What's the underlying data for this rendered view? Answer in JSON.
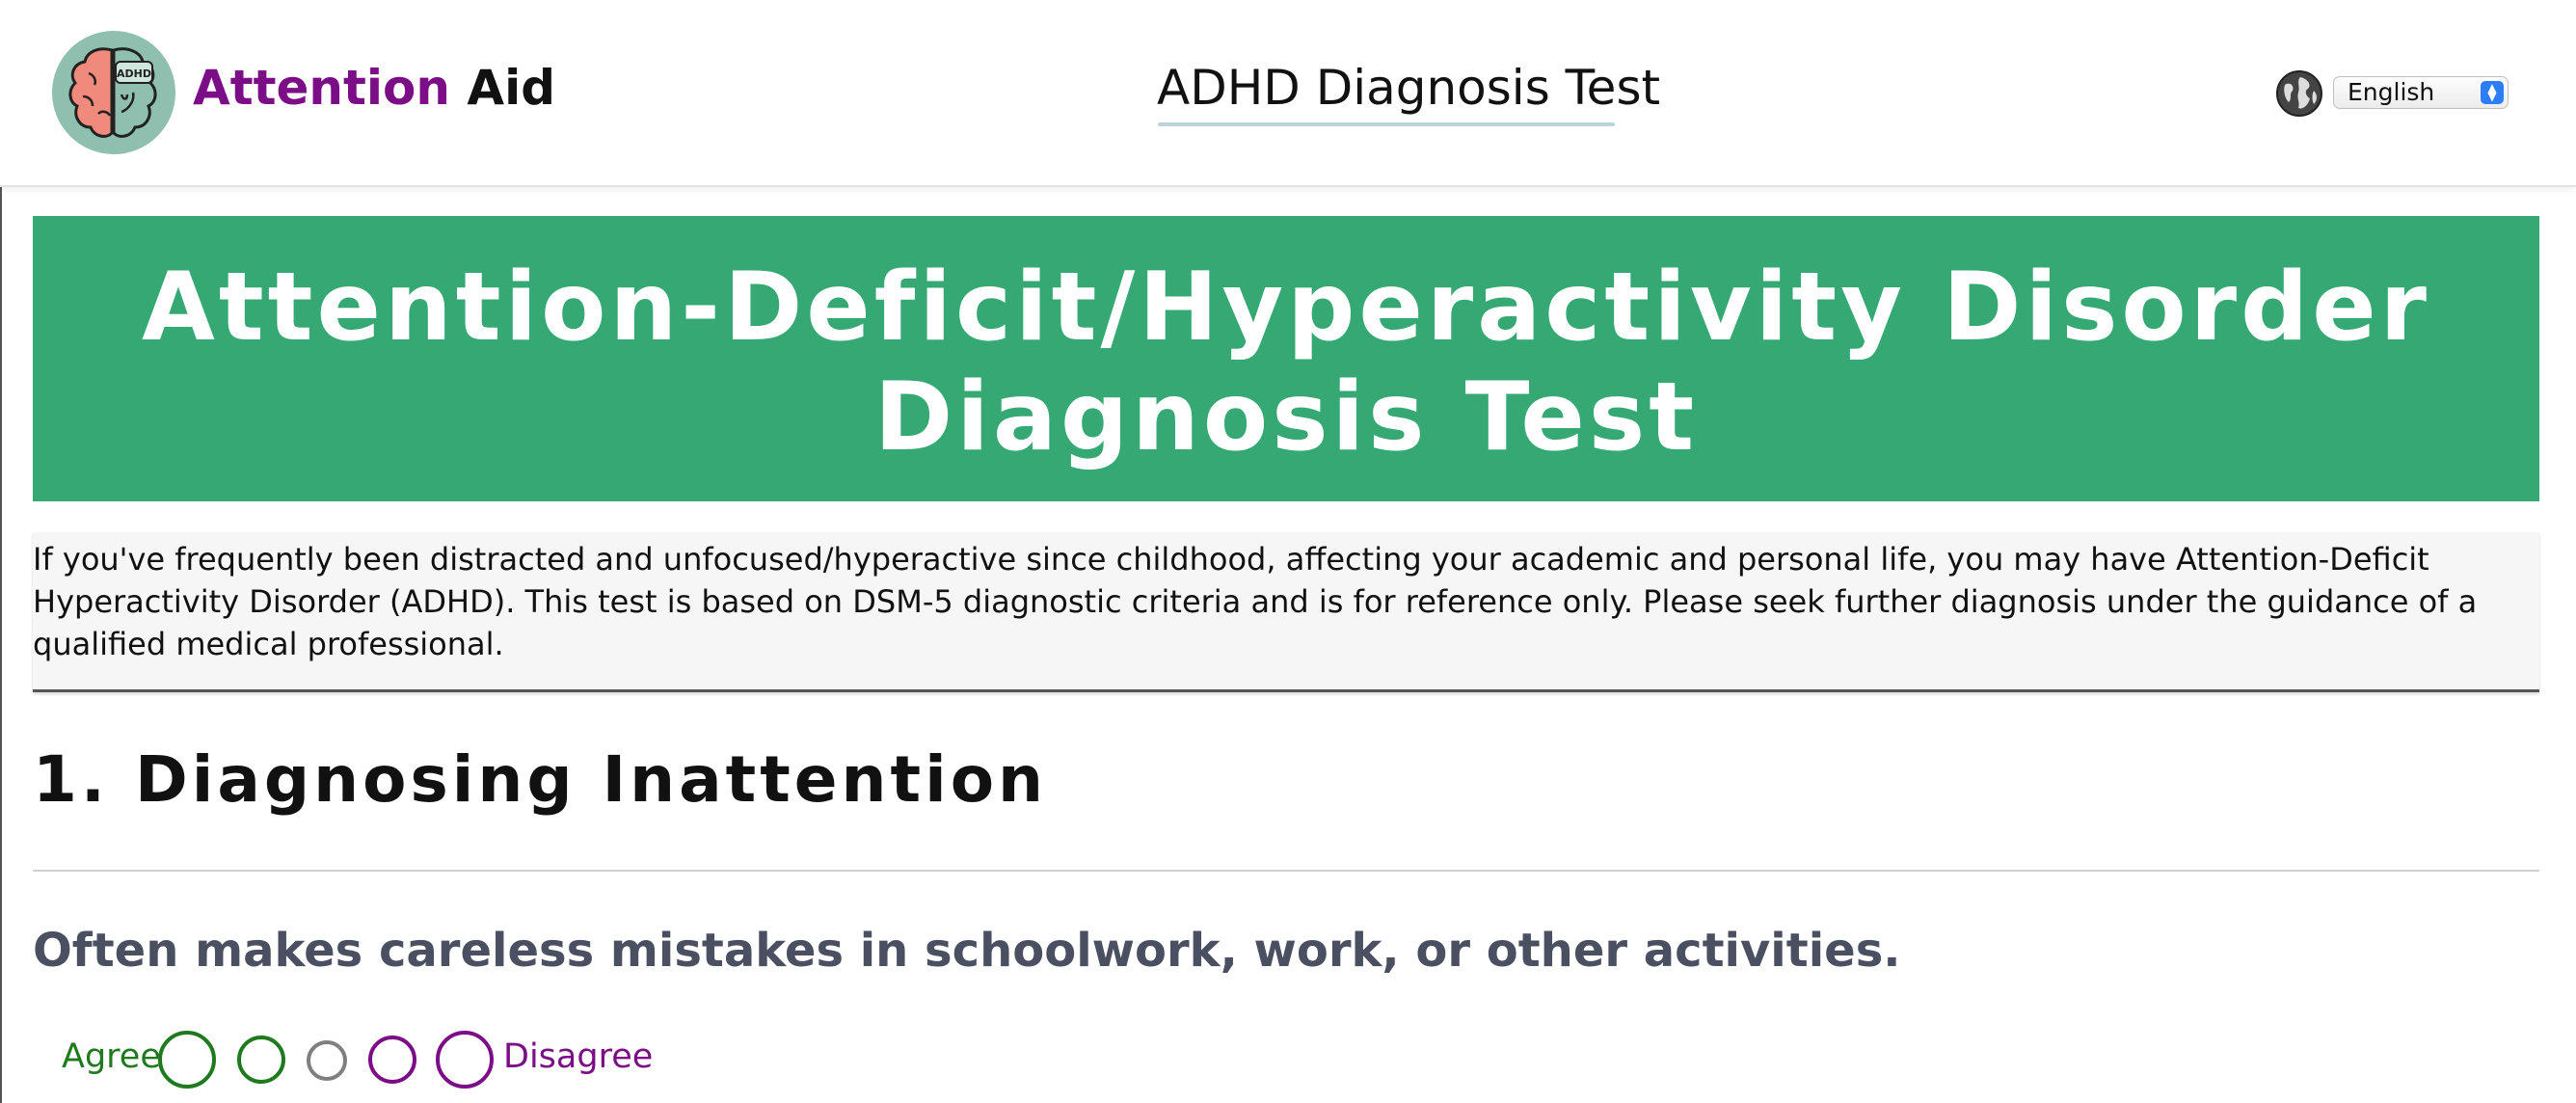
{
  "header": {
    "brand_part1": "Attention",
    "brand_part2": "Aid",
    "logo_badge_text": "ADHD",
    "title": "ADHD Diagnosis Test",
    "language": {
      "selected": "English"
    }
  },
  "banner": {
    "line1": "Attention-Deficit/Hyperactivity Disorder",
    "line2": "Diagnosis Test"
  },
  "intro": {
    "text": "If you've frequently been distracted and unfocused/hyperactive since childhood, affecting your academic and personal life, you may have Attention-Deficit Hyperactivity Disorder (ADHD). This test is based on DSM-5 diagnostic criteria and is for reference only. Please seek further diagnosis under the guidance of a qualified medical professional."
  },
  "section": {
    "title": "1. Diagnosing Inattention",
    "question": "Often makes careless mistakes in schoolwork, work, or other activities.",
    "scale": {
      "agree_label": "Agree",
      "disagree_label": "Disagree",
      "options_count": 5,
      "colors": [
        "#1f7a1f",
        "#1f7a1f",
        "#7f7f7f",
        "#7b0d86",
        "#7b0d86"
      ]
    }
  },
  "colors": {
    "brand_purple": "#7b0d86",
    "banner_green": "#35a873",
    "question_gray": "#4a5061",
    "agree_green": "#1f7a1f"
  }
}
